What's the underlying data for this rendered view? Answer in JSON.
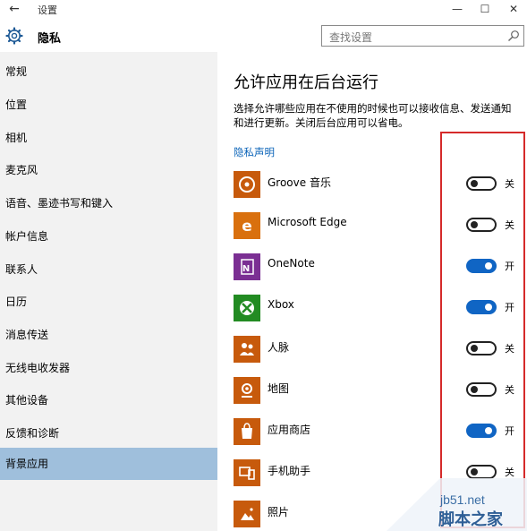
{
  "window": {
    "title": "设置",
    "back_glyph": "←",
    "min_glyph": "—",
    "max_glyph": "☐",
    "close_glyph": "✕"
  },
  "header": {
    "title": "隐私",
    "search_placeholder": "查找设置"
  },
  "sidebar": {
    "items": [
      {
        "label": "常规",
        "active": false
      },
      {
        "label": "位置",
        "active": false
      },
      {
        "label": "相机",
        "active": false
      },
      {
        "label": "麦克风",
        "active": false
      },
      {
        "label": "语音、墨迹书写和键入",
        "active": false
      },
      {
        "label": "帐户信息",
        "active": false
      },
      {
        "label": "联系人",
        "active": false
      },
      {
        "label": "日历",
        "active": false
      },
      {
        "label": "消息传送",
        "active": false
      },
      {
        "label": "无线电收发器",
        "active": false
      },
      {
        "label": "其他设备",
        "active": false
      },
      {
        "label": "反馈和诊断",
        "active": false
      },
      {
        "label": "背景应用",
        "active": true
      }
    ]
  },
  "main": {
    "title": "允许应用在后台运行",
    "description": "选择允许哪些应用在不使用的时候也可以接收信息、发送通知和进行更新。关闭后台应用可以省电。",
    "privacy_link": "隐私声明",
    "apps": [
      {
        "name": "Groove 音乐",
        "icon": "groove-music-icon",
        "on": false,
        "state_label": "关",
        "color": "#c75a0c"
      },
      {
        "name": "Microsoft Edge",
        "icon": "edge-icon",
        "on": false,
        "state_label": "关",
        "color": "#d9700e"
      },
      {
        "name": "OneNote",
        "icon": "onenote-icon",
        "on": true,
        "state_label": "开",
        "color": "#7b2f93"
      },
      {
        "name": "Xbox",
        "icon": "xbox-icon",
        "on": true,
        "state_label": "开",
        "color": "#228b22"
      },
      {
        "name": "人脉",
        "icon": "people-icon",
        "on": false,
        "state_label": "关",
        "color": "#c75a0c"
      },
      {
        "name": "地图",
        "icon": "maps-icon",
        "on": false,
        "state_label": "关",
        "color": "#c75a0c"
      },
      {
        "name": "应用商店",
        "icon": "store-icon",
        "on": true,
        "state_label": "开",
        "color": "#c75a0c"
      },
      {
        "name": "手机助手",
        "icon": "phone-companion-icon",
        "on": false,
        "state_label": "关",
        "color": "#c75a0c"
      },
      {
        "name": "照片",
        "icon": "photos-icon",
        "on": false,
        "state_label": "",
        "color": "#c75a0c"
      }
    ]
  },
  "colors": {
    "accent": "#1065c4",
    "link": "#0a63b8",
    "sidebar_bg": "#f2f2f2",
    "active_bg": "#9fbfdc",
    "highlight_border": "#d52a2a"
  },
  "watermark": {
    "line1": "jb51.net",
    "line2": "脚本之家"
  }
}
